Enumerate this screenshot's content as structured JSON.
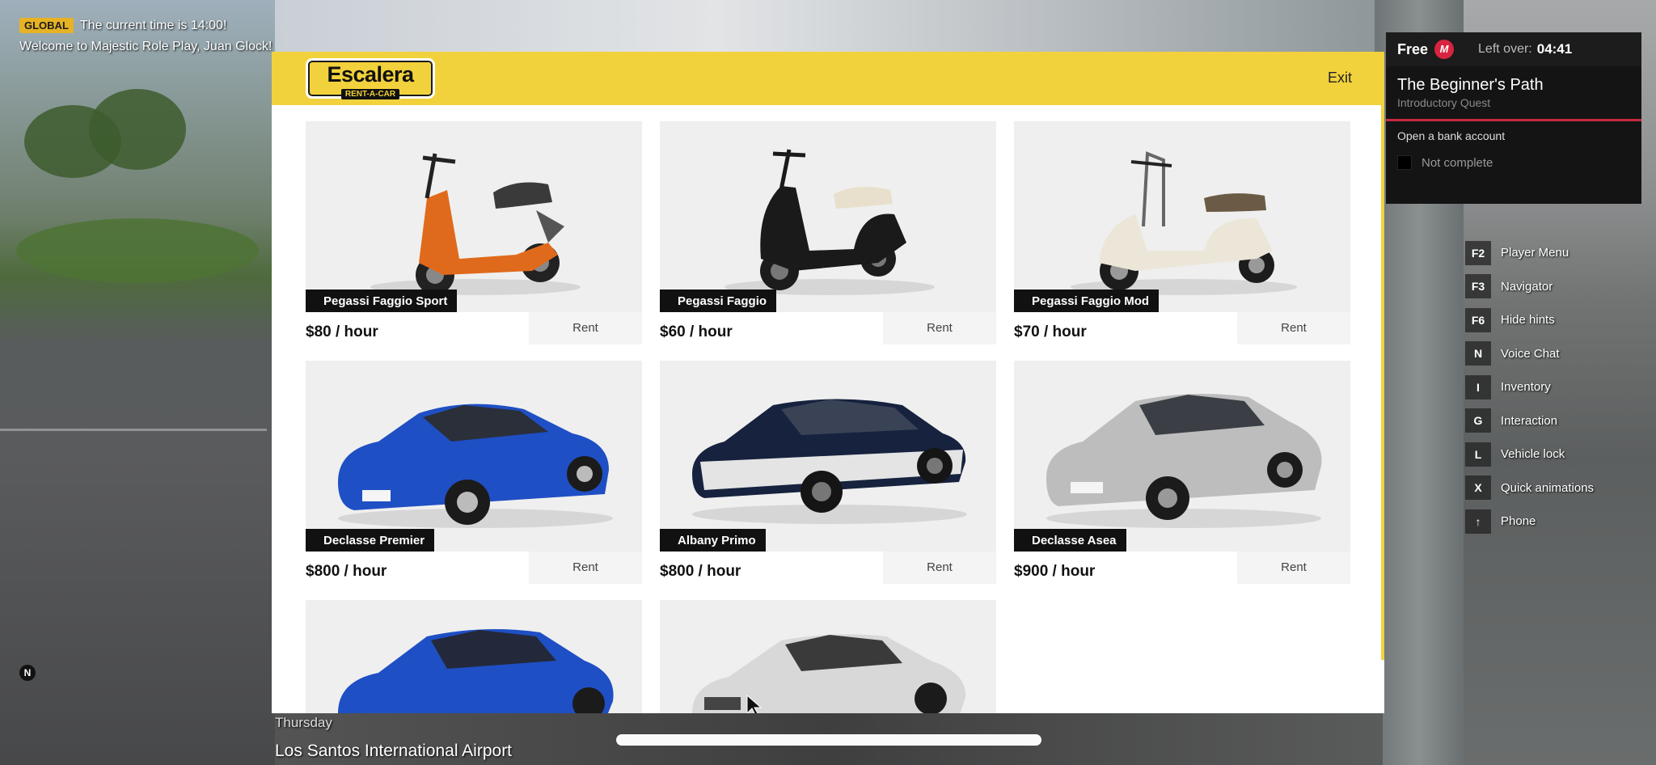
{
  "chat": {
    "badge": "GLOBAL",
    "time_message": "The current time is 14:00!",
    "welcome_message": "Welcome to Majestic Role Play, Juan Glock!"
  },
  "rental": {
    "logo_main": "Escalera",
    "logo_sub": "RENT-A-CAR",
    "exit_label": "Exit",
    "rent_label": "Rent",
    "vehicles": [
      {
        "name": "Pegassi Faggio Sport",
        "price": "$80 / hour",
        "color": "#e06a1b"
      },
      {
        "name": "Pegassi Faggio",
        "price": "$60 / hour",
        "color": "#1a1a1a"
      },
      {
        "name": "Pegassi Faggio Mod",
        "price": "$70 / hour",
        "color": "#ece6d8"
      },
      {
        "name": "Declasse Premier",
        "price": "$800 / hour",
        "color": "#1f4fc4"
      },
      {
        "name": "Albany Primo",
        "price": "$800 / hour",
        "color": "#16223e"
      },
      {
        "name": "Declasse Asea",
        "price": "$900 / hour",
        "color": "#bdbdbd"
      },
      {
        "name": "",
        "price": "",
        "color": "#1f4fc4"
      },
      {
        "name": "",
        "price": "",
        "color": "#d8d8d8"
      }
    ]
  },
  "quest": {
    "free_label": "Free",
    "m_badge": "M",
    "left_over_label": "Left over:",
    "left_over_time": "04:41",
    "title": "The Beginner's Path",
    "subtitle": "Introductory Quest",
    "task": "Open a bank account",
    "status": "Not complete"
  },
  "hints": [
    {
      "key": "F2",
      "label": "Player Menu"
    },
    {
      "key": "F3",
      "label": "Navigator"
    },
    {
      "key": "F6",
      "label": "Hide hints"
    },
    {
      "key": "N",
      "label": "Voice Chat"
    },
    {
      "key": "I",
      "label": "Inventory"
    },
    {
      "key": "G",
      "label": "Interaction"
    },
    {
      "key": "L",
      "label": "Vehicle lock"
    },
    {
      "key": "X",
      "label": "Quick animations"
    },
    {
      "key": "↑",
      "label": "Phone"
    }
  ],
  "location": {
    "day": "Thursday",
    "place": "Los Santos International Airport"
  },
  "compass": "N"
}
